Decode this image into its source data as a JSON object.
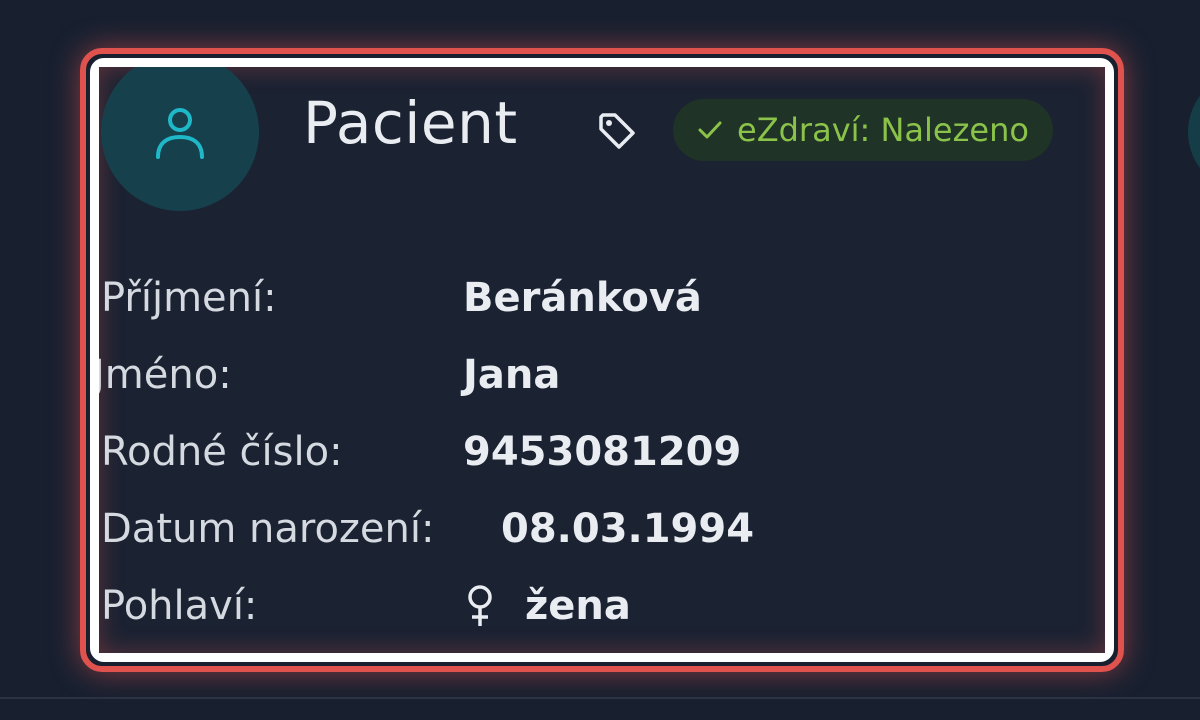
{
  "card": {
    "title": "Pacient",
    "status_badge": "eZdraví: Nalezeno"
  },
  "fields": {
    "surname_label": "Příjmení:",
    "surname_value": "Beránková",
    "name_label": "Jméno:",
    "name_value": "Jana",
    "birth_number_label": "Rodné číslo:",
    "birth_number_value": "9453081209",
    "birth_date_label": "Datum narození:",
    "birth_date_value": "08.03.1994",
    "sex_label": "Pohlaví:",
    "sex_value": "žena"
  },
  "icons": {
    "avatar": "user-icon",
    "tag": "tag-icon",
    "badge": "check-icon",
    "sex": "female-icon"
  },
  "colors": {
    "background": "#182030",
    "card": "#1b2232",
    "avatar_bg": "#16414c",
    "avatar_icon": "#1fb8c9",
    "badge_bg": "#1f3327",
    "badge_text": "#8bc34a",
    "highlight_red": "#e0524d"
  }
}
